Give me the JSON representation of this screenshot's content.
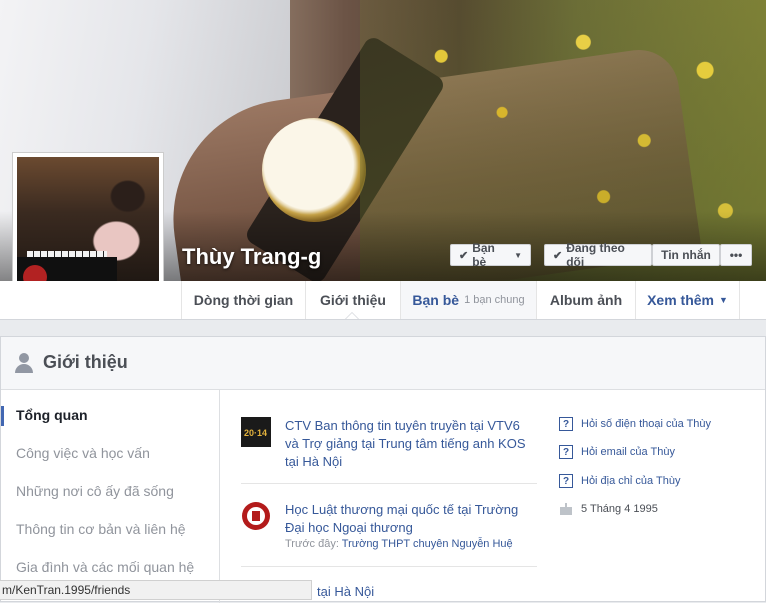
{
  "profile": {
    "name": "Thùy Trang-g"
  },
  "actions": {
    "friends": "Bạn bè",
    "following": "Đang theo dõi",
    "message": "Tin nhắn",
    "more": "•••"
  },
  "nav": {
    "timeline": "Dòng thời gian",
    "about": "Giới thiệu",
    "friends": "Bạn bè",
    "mutual": "1 bạn chung",
    "photos": "Album ảnh",
    "more": "Xem thêm"
  },
  "about": {
    "title": "Giới thiệu",
    "sidebar": [
      "Tổng quan",
      "Công việc và học vấn",
      "Những nơi cô ấy đã sống",
      "Thông tin cơ bản và liên hệ",
      "Gia đình và các mối quan hệ"
    ],
    "work": {
      "text": "CTV Ban thông tin tuyên truyền tại VTV6 và Trợ giảng tại Trung tâm tiếng anh KOS tại Hà Nội"
    },
    "education": {
      "text": "Học Luật thương mại quốc tế tại Trường Đại học Ngoại thương",
      "previous_label": "Trước đây:",
      "previous": "Trường THPT chuyên Nguyễn Huệ"
    },
    "location_partial": "tại Hà Nội",
    "right": {
      "phone": "Hỏi số điện thoại của Thùy",
      "email": "Hỏi email của Thùy",
      "address": "Hỏi địa chỉ của Thùy",
      "birthday": "5 Tháng 4 1995"
    }
  },
  "statusbar": {
    "url": "m/KenTran.1995/friends"
  },
  "colors": {
    "link": "#365899",
    "background": "#e9ebee",
    "accent": "#4267b2"
  }
}
